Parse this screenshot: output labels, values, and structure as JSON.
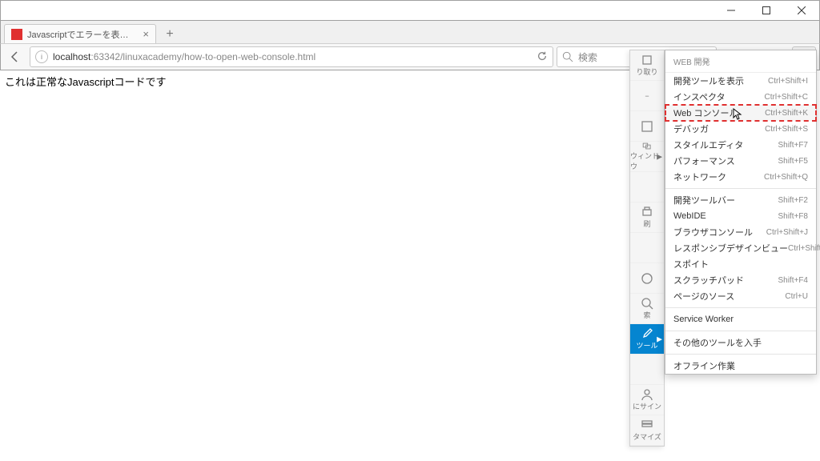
{
  "window": {
    "tab_title": "Javascriptでエラーを表示する...",
    "url_host": "localhost",
    "url_port_path": ":63342/linuxacademy/how-to-open-web-console.html",
    "search_placeholder": "検索"
  },
  "page": {
    "body_text": "これは正常なJavascriptコードです"
  },
  "ghost_panel": {
    "items": [
      {
        "label": "り取り"
      },
      {
        "label": "−"
      },
      {
        "label": ""
      },
      {
        "label": "ウィンドウ"
      },
      {
        "label": ""
      },
      {
        "label": "刷"
      },
      {
        "label": ""
      },
      {
        "label": ""
      },
      {
        "label": "索"
      },
      {
        "label": "ツール"
      },
      {
        "label": ""
      },
      {
        "label": "にサイン"
      },
      {
        "label": "タマイズ"
      }
    ]
  },
  "submenu": {
    "header": "WEB 開発",
    "groups": [
      [
        {
          "label": "開発ツールを表示",
          "shortcut": "Ctrl+Shift+I"
        },
        {
          "label": "インスペクタ",
          "shortcut": "Ctrl+Shift+C"
        },
        {
          "label": "Web コンソール",
          "shortcut": "Ctrl+Shift+K",
          "highlight": true
        },
        {
          "label": "デバッガ",
          "shortcut": "Ctrl+Shift+S"
        },
        {
          "label": "スタイルエディタ",
          "shortcut": "Shift+F7"
        },
        {
          "label": "パフォーマンス",
          "shortcut": "Shift+F5"
        },
        {
          "label": "ネットワーク",
          "shortcut": "Ctrl+Shift+Q"
        }
      ],
      [
        {
          "label": "開発ツールバー",
          "shortcut": "Shift+F2"
        },
        {
          "label": "WebIDE",
          "shortcut": "Shift+F8"
        },
        {
          "label": "ブラウザコンソール",
          "shortcut": "Ctrl+Shift+J"
        },
        {
          "label": "レスポンシブデザインビュー",
          "shortcut": "Ctrl+Shift+M"
        },
        {
          "label": "スポイト",
          "shortcut": ""
        },
        {
          "label": "スクラッチパッド",
          "shortcut": "Shift+F4"
        },
        {
          "label": "ページのソース",
          "shortcut": "Ctrl+U"
        }
      ],
      [
        {
          "label": "Service Worker",
          "shortcut": ""
        }
      ],
      [
        {
          "label": "その他のツールを入手",
          "shortcut": ""
        }
      ],
      [
        {
          "label": "オフライン作業",
          "shortcut": ""
        }
      ]
    ]
  }
}
